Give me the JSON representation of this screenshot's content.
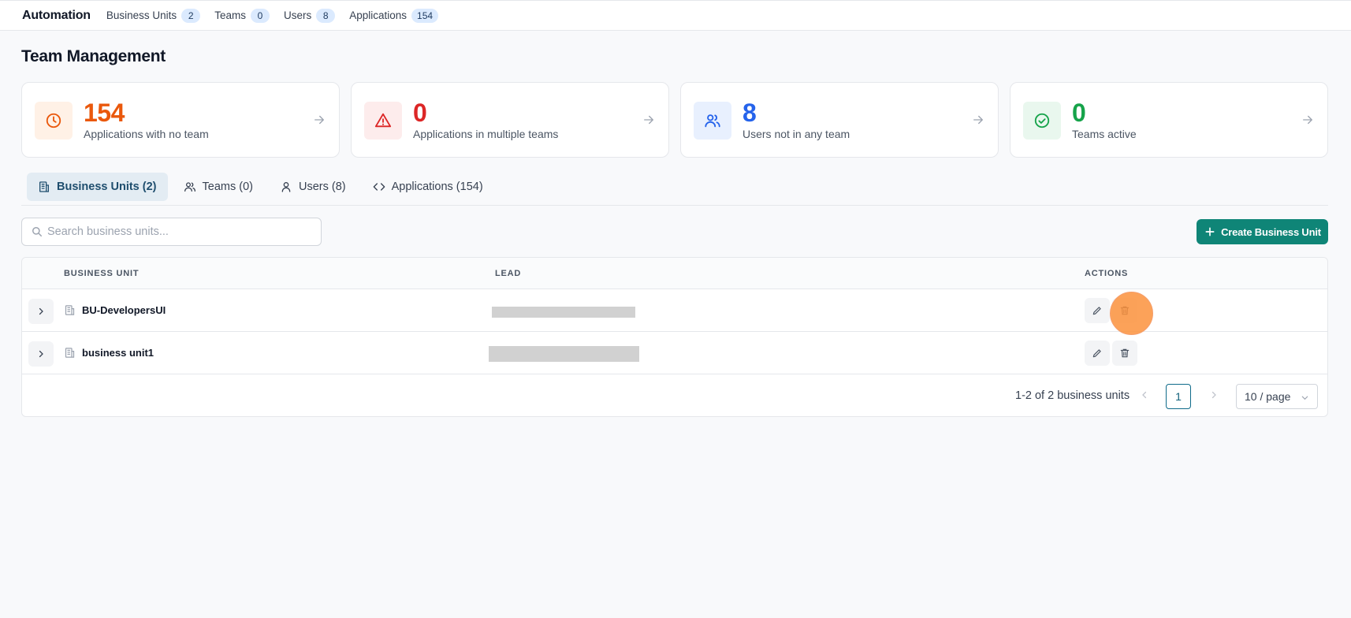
{
  "topbar": {
    "brand": "Automation",
    "nav": [
      {
        "label": "Business Units",
        "count": "2"
      },
      {
        "label": "Teams",
        "count": "0"
      },
      {
        "label": "Users",
        "count": "8"
      },
      {
        "label": "Applications",
        "count": "154"
      }
    ]
  },
  "page": {
    "title": "Team Management"
  },
  "cards": [
    {
      "value": "154",
      "label": "Applications with no team",
      "icon": "clock-icon",
      "color": "#ea580c",
      "bg": "#fff1e6"
    },
    {
      "value": "0",
      "label": "Applications in multiple teams",
      "icon": "warning-icon",
      "color": "#dc2626",
      "bg": "#fdecec"
    },
    {
      "value": "8",
      "label": "Users not in any team",
      "icon": "users-icon",
      "color": "#2563eb",
      "bg": "#e8f0fe"
    },
    {
      "value": "0",
      "label": "Teams active",
      "icon": "check-circle-icon",
      "color": "#16a34a",
      "bg": "#e9f7ee"
    }
  ],
  "tabs": [
    {
      "label": "Business Units (2)",
      "icon": "building-icon",
      "active": true
    },
    {
      "label": "Teams (0)",
      "icon": "users-icon"
    },
    {
      "label": "Users (8)",
      "icon": "user-icon"
    },
    {
      "label": "Applications (154)",
      "icon": "code-icon"
    }
  ],
  "search": {
    "placeholder": "Search business units..."
  },
  "create_button": {
    "label": "Create Business Unit"
  },
  "table": {
    "columns": [
      "BUSINESS UNIT",
      "LEAD",
      "ACTIONS"
    ],
    "rows": [
      {
        "name": "BU-DevelopersUI",
        "lead": ""
      },
      {
        "name": "business unit1",
        "lead": ""
      }
    ]
  },
  "pagination": {
    "summary": "1-2 of 2 business units",
    "current_page": "1",
    "page_size": "10 / page"
  },
  "colors": {
    "accent": "#0f8577",
    "tab_active_bg": "#e3ecf3"
  }
}
